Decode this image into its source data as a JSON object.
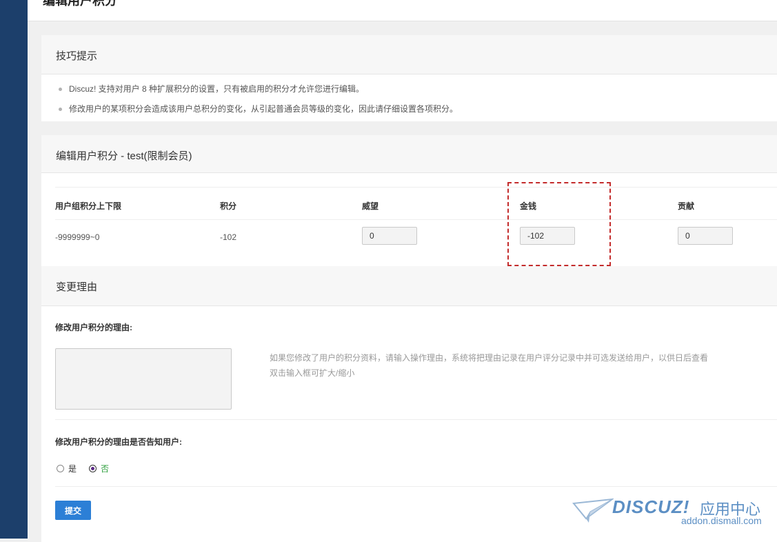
{
  "page": {
    "title": "编辑用户积分"
  },
  "tips": {
    "title": "技巧提示",
    "items": [
      "Discuz! 支持对用户 8 种扩展积分的设置，只有被启用的积分才允许您进行编辑。",
      "修改用户的某项积分会造成该用户总积分的变化，从引起普通会员等级的变化，因此请仔细设置各项积分。"
    ]
  },
  "edit": {
    "title": "编辑用户积分 - test(限制会员)",
    "columns": [
      "用户组积分上下限",
      "积分",
      "威望",
      "金钱",
      "贡献"
    ],
    "row": {
      "range": "-9999999~0",
      "credits": "-102",
      "prestige": "0",
      "money": "-102",
      "contribution": "0"
    }
  },
  "reason": {
    "title": "变更理由",
    "label": "修改用户积分的理由:",
    "hint_line1": "如果您修改了用户的积分资料，请输入操作理由，系统将把理由记录在用户评分记录中并可选发送给用户，以供日后查看",
    "hint_line2": "双击输入框可扩大/缩小",
    "notify_label": "修改用户积分的理由是否告知用户:",
    "yes": "是",
    "no": "否",
    "selected": "否",
    "submit": "提交"
  },
  "watermark": {
    "brand": "DISCUZ!",
    "cn": "应用中心",
    "url": "addon.dismall.com"
  },
  "colors": {
    "sidebar": "#1c3f6b",
    "button": "#2c7fd6",
    "highlight": "#c32b2b"
  }
}
